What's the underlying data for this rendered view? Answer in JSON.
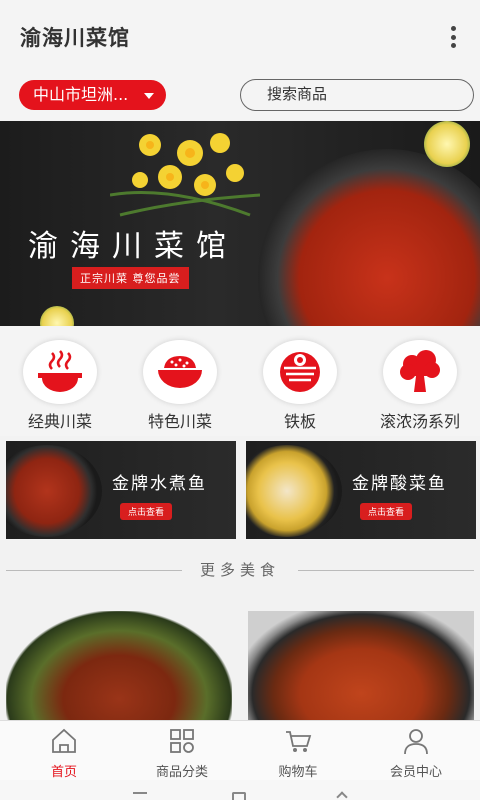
{
  "header": {
    "title": "渝海川菜馆",
    "menu_icon": "more-vertical-icon"
  },
  "location": {
    "label": "中山市坦洲...",
    "icon": "caret-down-icon"
  },
  "search": {
    "placeholder": "搜索商品"
  },
  "banner": {
    "title": "渝海川菜馆",
    "subtitle": "正宗川菜  尊您品尝"
  },
  "categories": [
    {
      "label": "经典川菜",
      "icon": "hotpot-icon"
    },
    {
      "label": "特色川菜",
      "icon": "rice-bowl-icon"
    },
    {
      "label": "铁板",
      "icon": "noodle-bowl-icon"
    },
    {
      "label": "滚浓汤系列",
      "icon": "broccoli-icon"
    }
  ],
  "promos": [
    {
      "title": "金牌水煮鱼",
      "button": "点击查看"
    },
    {
      "title": "金牌酸菜鱼",
      "button": "点击查看"
    }
  ],
  "section": {
    "more_food": "更多美食"
  },
  "tabbar": [
    {
      "label": "首页",
      "icon": "home-icon",
      "active": true
    },
    {
      "label": "商品分类",
      "icon": "grid-icon",
      "active": false
    },
    {
      "label": "购物车",
      "icon": "cart-icon",
      "active": false
    },
    {
      "label": "会员中心",
      "icon": "user-icon",
      "active": false
    }
  ],
  "colors": {
    "accent": "#e4131c",
    "text": "#333333",
    "background": "#f2f2f2"
  }
}
